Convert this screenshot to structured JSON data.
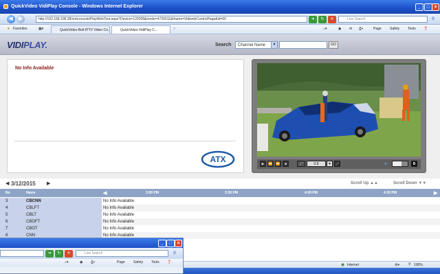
{
  "window": {
    "title": "QuickVideo VidiPlay Console - Windows Internet Explorer",
    "buttons": [
      "_",
      "□",
      "×"
    ]
  },
  "browser": {
    "address": "http://192.168.108.28/xmlconsole/PlayWebTour.aspx?Device=120208&mode=4720011&iframe=VidiwebControlPage&id=00",
    "search_placeholder": "Live Search",
    "favorites_label": "Favorites",
    "tabs": [
      "QuickVideo Bolt IPTV Video Co...",
      "QuickVideo VidiPlay C..."
    ],
    "tools": [
      "Page",
      "Safety",
      "Tools"
    ],
    "status_zone": "Internet",
    "zoom": "100%"
  },
  "app": {
    "logo_main": "VIDI",
    "logo_sub": "PLAY.",
    "search_label": "Search",
    "search_select": "Channel Name",
    "search_value": "",
    "go_label": "GO",
    "info_text": "No Info Available",
    "atx_logo": "ATX",
    "player": {
      "channel_select": "0.8",
      "buttons": [
        "play-icon",
        "rewind-icon",
        "forward-icon",
        "stop-icon",
        "fullscreen-icon",
        "volume-icon"
      ]
    }
  },
  "guide": {
    "date": "3/12/2015",
    "scroll_up": "Scroll Up",
    "scroll_down": "Scroll Down",
    "header": {
      "no": "No",
      "name": "Name"
    },
    "times": [
      "3:00 PM",
      "3:30 PM",
      "4:00 PM",
      "4:30 PM"
    ],
    "rows": [
      {
        "no": "3",
        "name": "CBCNN",
        "info": "No Info Available"
      },
      {
        "no": "4",
        "name": "CBLFT",
        "info": "No Info Available"
      },
      {
        "no": "5",
        "name": "CBLT",
        "info": "No Info Available"
      },
      {
        "no": "6",
        "name": "CBOFT",
        "info": "No Info Available"
      },
      {
        "no": "7",
        "name": "CBOT",
        "info": "No Info Available"
      },
      {
        "no": "8",
        "name": "CNN",
        "info": "No Info Available"
      }
    ]
  },
  "overlay_window": {
    "search_placeholder": "Live Search",
    "tools": [
      "Page",
      "Safety",
      "Tools"
    ]
  },
  "colors": {
    "title_blue": "#1c4fc7",
    "header_bar": "#8da4c7",
    "info_red": "#8b1a1a",
    "logo_navy": "#25306c"
  }
}
